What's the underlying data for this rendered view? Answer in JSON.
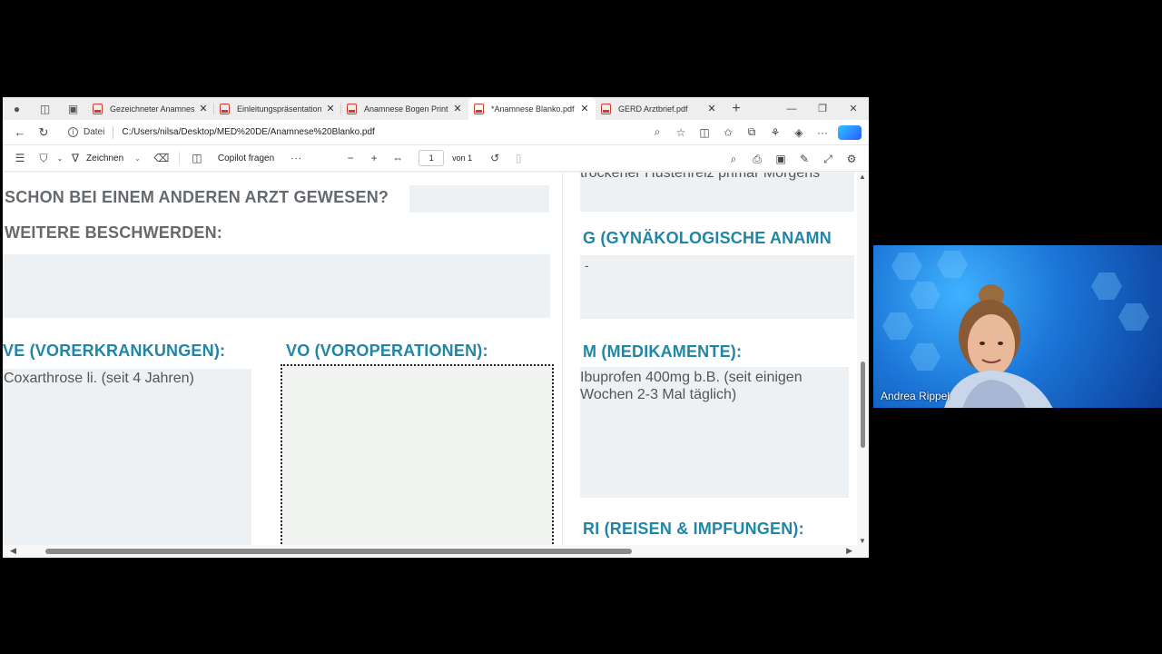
{
  "browser": {
    "tabs": [
      {
        "title": "Gezeichneter Anamnese",
        "active": false
      },
      {
        "title": "Einleitungspräsentation",
        "active": false
      },
      {
        "title": "Anamnese Bogen Print",
        "active": false
      },
      {
        "title": "*Anamnese Blanko.pdf",
        "active": true
      },
      {
        "title": "GERD Arztbrief.pdf",
        "active": false
      }
    ],
    "address": {
      "label": "Datei",
      "url": "C:/Users/nilsa/Desktop/MED%20DE/Anamnese%20Blanko.pdf"
    }
  },
  "pdf_toolbar": {
    "draw_label": "Zeichnen",
    "copilot_label": "Copilot fragen",
    "more_label": "···",
    "page_number": "1",
    "page_of": "von 1"
  },
  "document": {
    "top_right_text": "trockener Hustenreiz primär Morgens",
    "q_other_doctor": "SCHON BEI EINEM ANDEREN ARZT GEWESEN?",
    "q_further_complaints": "WEITERE BESCHWERDEN:",
    "g_heading": "G (GYNÄKOLOGISCHE ANAMN",
    "g_value": "-",
    "ve_heading": "VE (VORERKRANKUNGEN):",
    "ve_value": "Coxarthrose li. (seit 4 Jahren)",
    "vo_heading": "VO (VOROPERATIONEN):",
    "m_heading": "M (MEDIKAMENTE):",
    "m_value": "Ibuprofen 400mg b.B. (seit einigen Wochen 2-3 Mal täglich)",
    "ri_heading": "RI (REISEN & IMPFUNGEN):"
  },
  "video": {
    "participant_name": "Andrea Rippel"
  },
  "colors": {
    "heading_gray": "#666a6e",
    "heading_blue": "#1f86a8",
    "field_bg": "#edf1f4"
  }
}
